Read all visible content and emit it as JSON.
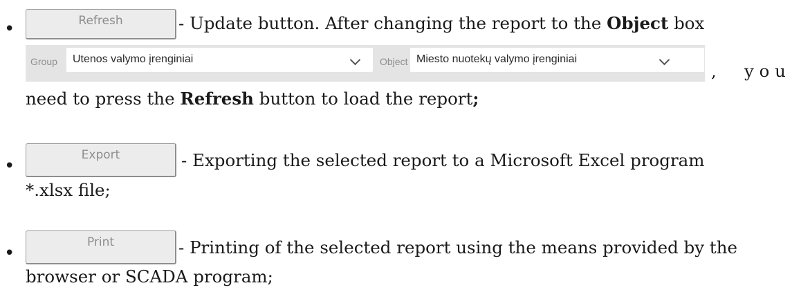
{
  "item1": {
    "button_label": "Refresh",
    "desc_pre": "- Update button. After changing the report to the",
    "desc_bold": "Object",
    "desc_post": "box",
    "group_label": "Group",
    "group_value": "Utenos valymo įrenginiai",
    "object_label": "Object",
    "object_value": "Miesto nuotekų valymo įrenginiai",
    "comma": ",",
    "you": "y o u",
    "line2_pre": "need to press the",
    "line2_bold": "Refresh",
    "line2_post": "button to load the report",
    "line2_end": ";"
  },
  "item2": {
    "button_label": "Export",
    "desc": "- Exporting the selected report to a Microsoft Excel program",
    "desc_cont": "*.xlsx file;"
  },
  "item3": {
    "button_label": "Print",
    "desc": "- Printing of the selected report using the means provided by the",
    "desc_cont": "browser or SCADA program;"
  }
}
